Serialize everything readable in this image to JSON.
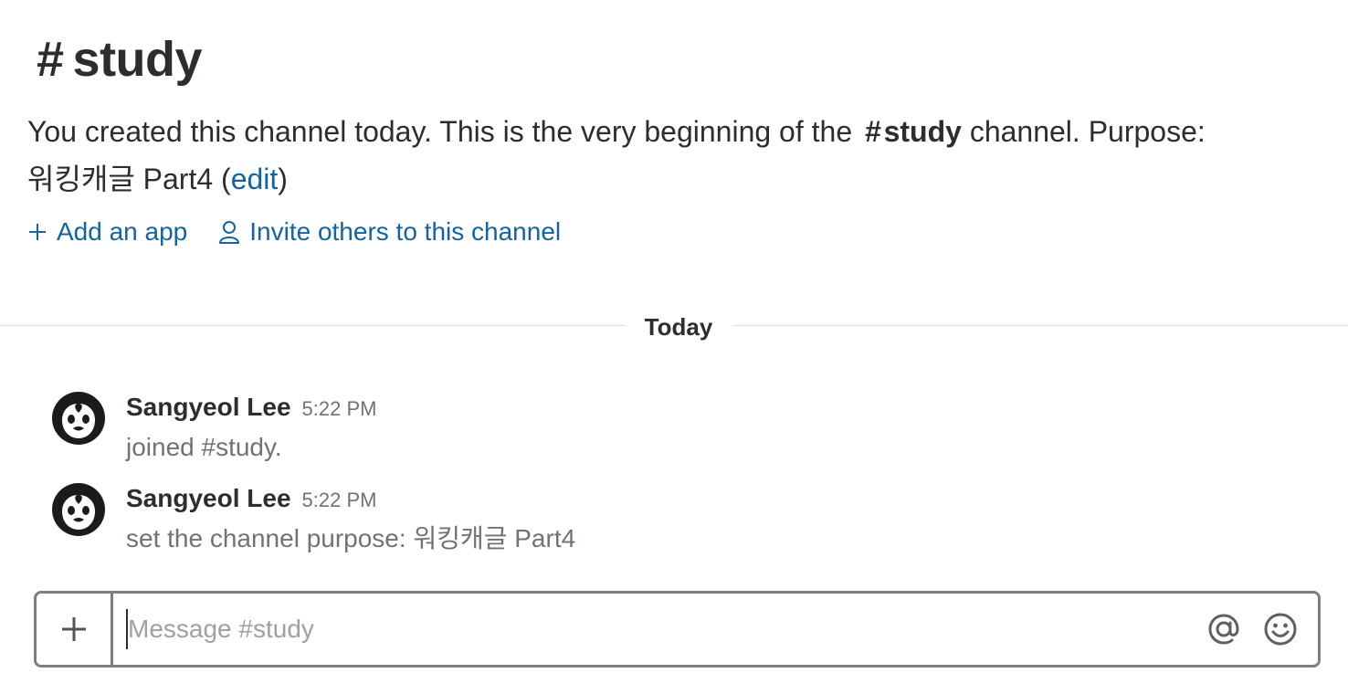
{
  "channel": {
    "hash": "#",
    "name": "study"
  },
  "intro": {
    "text_before": "You created this channel today. This is the very beginning of the",
    "hash": "#",
    "channel_name": "study",
    "text_after": " channel. Purpose: ",
    "purpose": "워킹캐글 Part4",
    "paren_open": " (",
    "edit_link": "edit",
    "paren_close": ")"
  },
  "actions": {
    "add_app": {
      "label": "Add an app",
      "icon": "plus-icon"
    },
    "invite": {
      "label": "Invite others to this channel",
      "icon": "person-icon"
    }
  },
  "divider": {
    "label": "Today"
  },
  "messages": [
    {
      "sender": "Sangyeol Lee",
      "time": "5:22 PM",
      "text": "joined #study.",
      "avatar": "penguin-avatar"
    },
    {
      "sender": "Sangyeol Lee",
      "time": "5:22 PM",
      "text": "set the channel purpose: 워킹캐글 Part4",
      "avatar": "penguin-avatar"
    }
  ],
  "composer": {
    "placeholder": "Message #study",
    "value": "",
    "plus_icon": "plus-icon",
    "mention_icon": "at-icon",
    "emoji_icon": "smiley-icon"
  },
  "colors": {
    "link": "#1264a3",
    "text": "#2c2d30",
    "muted": "#717274",
    "border": "#7f7f81"
  }
}
